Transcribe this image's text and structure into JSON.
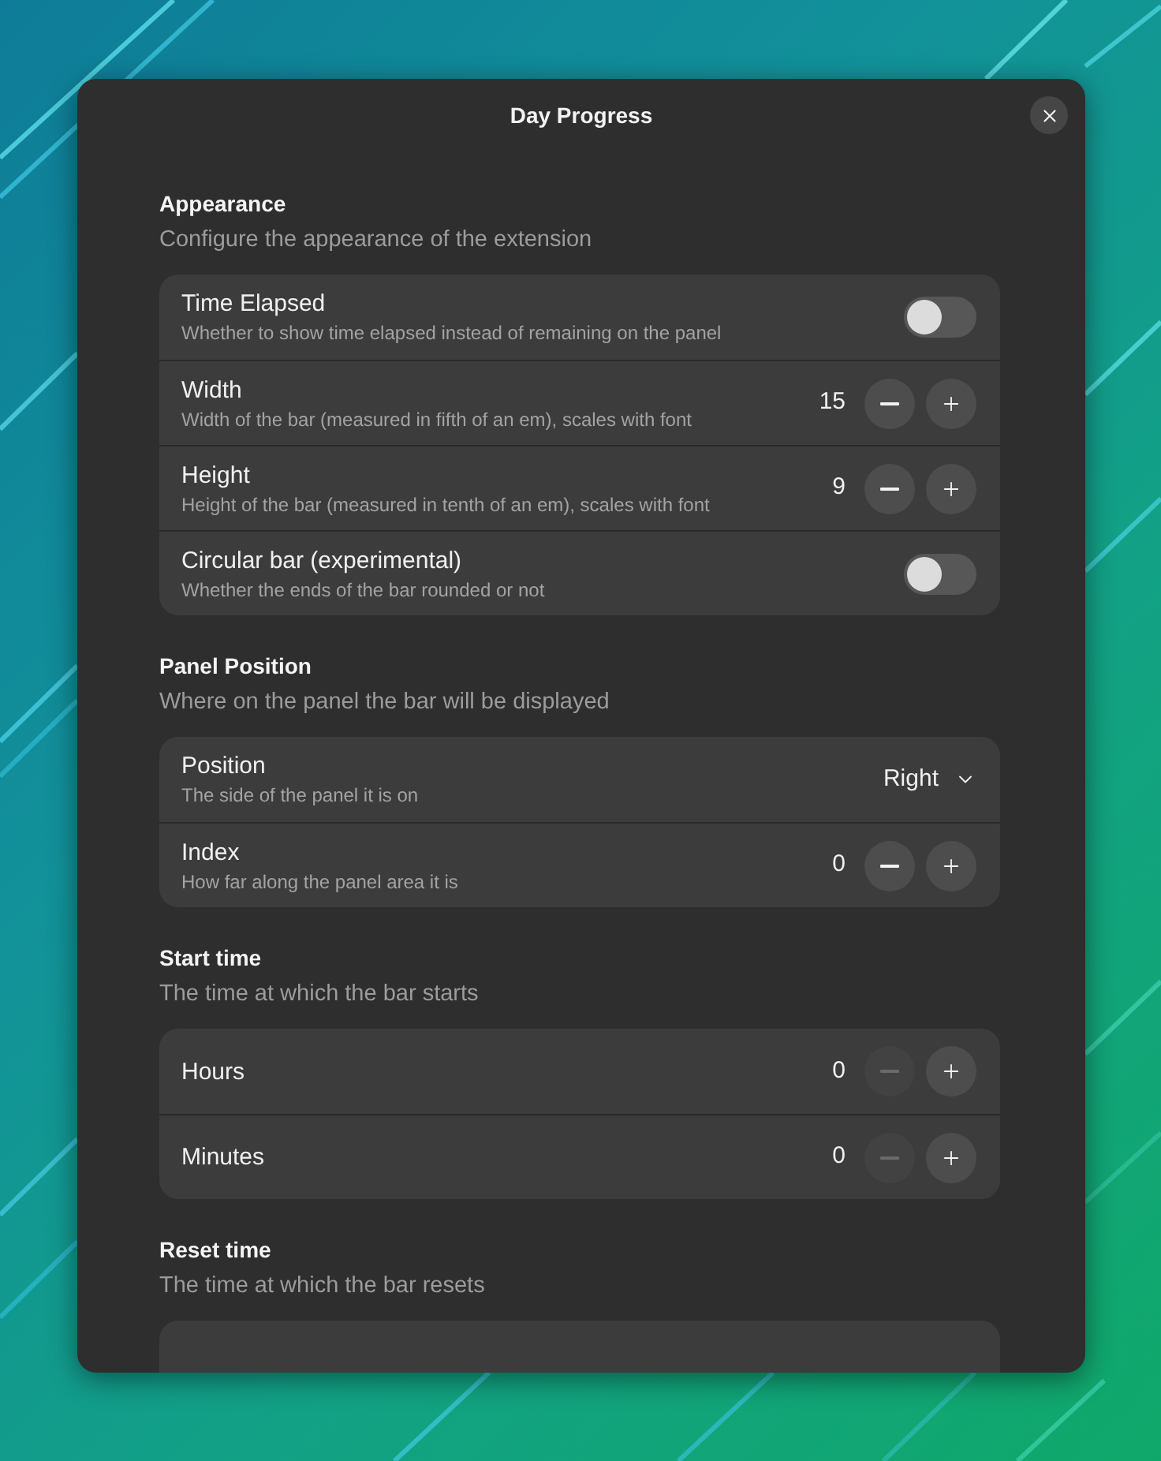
{
  "window": {
    "title": "Day Progress"
  },
  "sections": [
    {
      "title": "Appearance",
      "subtitle": "Configure the appearance of the extension",
      "rows": [
        {
          "kind": "switch",
          "title": "Time Elapsed",
          "subtitle": "Whether to show time elapsed instead of remaining on the panel",
          "on": false
        },
        {
          "kind": "spin",
          "title": "Width",
          "subtitle": "Width of the bar (measured in fifth of an em), scales with font",
          "value": "15",
          "minus_disabled": false
        },
        {
          "kind": "spin",
          "title": "Height",
          "subtitle": "Height of the bar (measured in tenth of an em), scales with font",
          "value": "9",
          "minus_disabled": false
        },
        {
          "kind": "switch",
          "title": "Circular bar (experimental)",
          "subtitle": "Whether the ends of the bar rounded or not",
          "on": false
        }
      ]
    },
    {
      "title": "Panel Position",
      "subtitle": "Where on the panel the bar will be displayed",
      "rows": [
        {
          "kind": "dropdown",
          "title": "Position",
          "subtitle": "The side of the panel it is on",
          "value": "Right"
        },
        {
          "kind": "spin",
          "title": "Index",
          "subtitle": "How far along the panel area it is",
          "value": "0",
          "minus_disabled": false
        }
      ]
    },
    {
      "title": "Start time",
      "subtitle": "The time at which the bar starts",
      "rows": [
        {
          "kind": "spin",
          "title": "Hours",
          "value": "0",
          "minus_disabled": true
        },
        {
          "kind": "spin",
          "title": "Minutes",
          "value": "0",
          "minus_disabled": true
        }
      ]
    },
    {
      "title": "Reset time",
      "subtitle": "The time at which the bar resets"
    }
  ]
}
